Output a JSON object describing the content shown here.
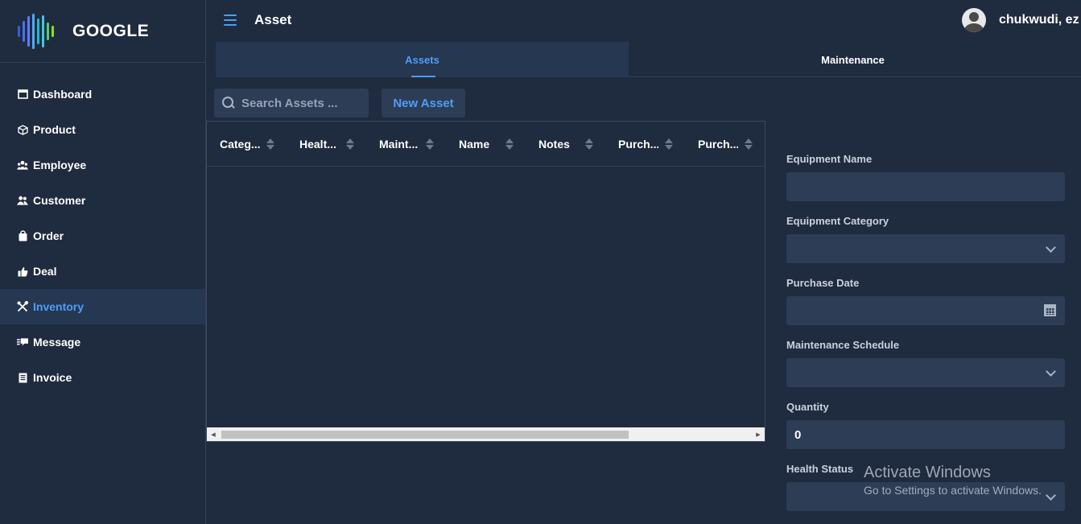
{
  "brand": {
    "name": "GOOGLE",
    "logo_colors": [
      "#3b5bdb",
      "#4c6ef5",
      "#5c7cfa",
      "#22b8cf",
      "#3bc9db",
      "#51cf66",
      "#94d82d"
    ]
  },
  "sidebar": {
    "items": [
      {
        "label": "Dashboard",
        "icon": "window-icon"
      },
      {
        "label": "Product",
        "icon": "cube-icon"
      },
      {
        "label": "Employee",
        "icon": "users-icon"
      },
      {
        "label": "Customer",
        "icon": "customers-icon"
      },
      {
        "label": "Order",
        "icon": "shopping-bag-icon"
      },
      {
        "label": "Deal",
        "icon": "thumbs-up-icon"
      },
      {
        "label": "Inventory",
        "icon": "tools-icon",
        "active": true
      },
      {
        "label": "Message",
        "icon": "comments-icon"
      },
      {
        "label": "Invoice",
        "icon": "file-icon"
      }
    ]
  },
  "header": {
    "title": "Asset",
    "user_name": "chukwudi, ez"
  },
  "tabs": [
    {
      "label": "Assets",
      "active": true
    },
    {
      "label": "Maintenance"
    }
  ],
  "toolbar": {
    "search_placeholder": "Search Assets ...",
    "new_button": "New Asset"
  },
  "grid": {
    "columns": [
      "Categ...",
      "Healt...",
      "Maint...",
      "Name",
      "Notes",
      "Purch...",
      "Purch..."
    ],
    "rows": []
  },
  "form": {
    "equipment_name": {
      "label": "Equipment Name",
      "value": ""
    },
    "equipment_category": {
      "label": "Equipment Category",
      "value": ""
    },
    "purchase_date": {
      "label": "Purchase Date",
      "value": ""
    },
    "maintenance_schedule": {
      "label": "Maintenance Schedule",
      "value": ""
    },
    "quantity": {
      "label": "Quantity",
      "value": "0"
    },
    "health_status": {
      "label": "Health Status",
      "value": ""
    }
  },
  "watermark": {
    "title": "Activate Windows",
    "subtitle": "Go to Settings to activate Windows."
  },
  "colors": {
    "accent": "#4d9ef7",
    "background": "#1f2b3e",
    "input": "#2e3d56",
    "active_nav": "#263752"
  }
}
